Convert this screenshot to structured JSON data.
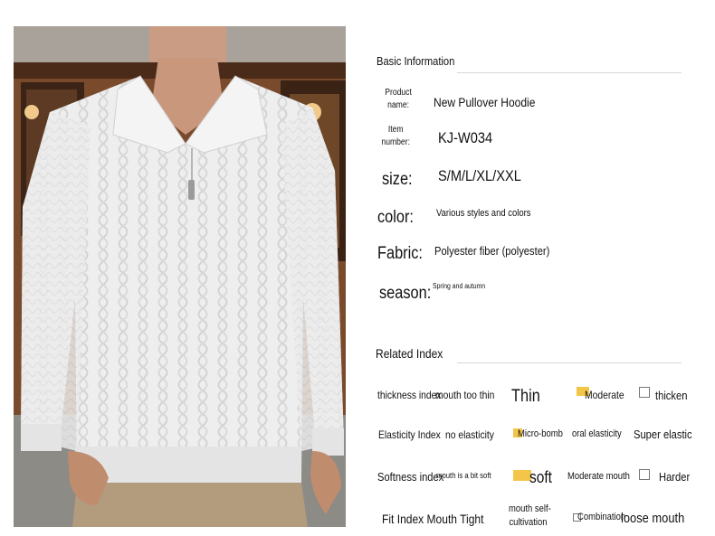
{
  "image_alt": "Man wearing a white cable-knit quarter-zip pullover",
  "basic": {
    "title": "Basic Information",
    "product_label_line1": "Product",
    "product_label_line2": "name:",
    "product_value": "New Pullover Hoodie",
    "item_label_line1": "Item",
    "item_label_line2": "number:",
    "item_value": "KJ-W034",
    "size_label": "size:",
    "size_value": "S/M/L/XL/XXL",
    "color_label": "color:",
    "color_value": "Various styles and colors",
    "fabric_label": "Fabric:",
    "fabric_value": "Polyester fiber (polyester)",
    "season_label": "season:",
    "season_value": "Spring and autumn"
  },
  "related": {
    "title": "Related Index",
    "thickness": {
      "label": "thickness index",
      "opt1": "mouth too thin",
      "opt2": "Thin",
      "opt3": "Moderate",
      "opt4": "thicken",
      "selected": "Moderate"
    },
    "elasticity": {
      "label": "Elasticity Index",
      "opt1": "no elasticity",
      "opt2": "Micro-bomb",
      "opt3": "oral elasticity",
      "opt4": "Super elastic",
      "selected": "Micro-bomb"
    },
    "softness": {
      "label": "Softness index",
      "opt1": "mouth is a bit soft",
      "opt2": "soft",
      "opt3": "Moderate mouth",
      "opt4": "Harder",
      "selected": "soft"
    },
    "fit": {
      "label": "Fit Index Mouth Tight",
      "opt2_line1": "mouth self-",
      "opt2_line2": "cultivation",
      "opt3": "Combination",
      "opt4": "loose mouth"
    }
  },
  "colors": {
    "marker": "#f3c649",
    "sweater": "#ededed",
    "background_wood": "#6b3f26"
  }
}
